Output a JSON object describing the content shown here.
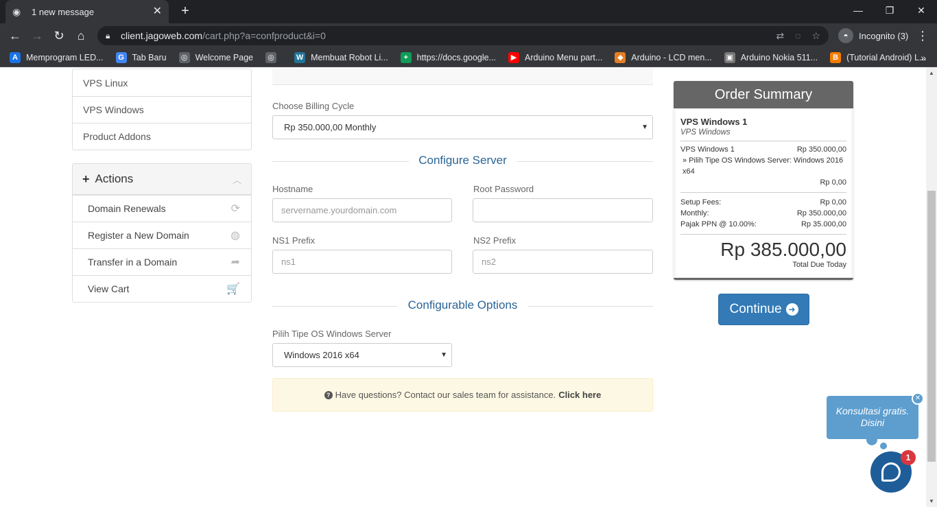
{
  "browser": {
    "tab_title": "1 new message",
    "url_host": "client.jagoweb.com",
    "url_path": "/cart.php?a=confproduct&i=0",
    "incognito_label": "Incognito (3)",
    "bookmarks": [
      {
        "label": "Memprogram LED...",
        "icon": "A",
        "color": "#1a73e8"
      },
      {
        "label": "Tab Baru",
        "icon": "G",
        "color": "#4285f4"
      },
      {
        "label": "Welcome Page",
        "icon": "◎",
        "color": "#5f6368"
      },
      {
        "label": "",
        "icon": "◎",
        "color": "#5f6368"
      },
      {
        "label": "Membuat Robot Li...",
        "icon": "W",
        "color": "#21759b"
      },
      {
        "label": "https://docs.google...",
        "icon": "+",
        "color": "#0f9d58"
      },
      {
        "label": "Arduino Menu part...",
        "icon": "▶",
        "color": "#ff0000"
      },
      {
        "label": "Arduino - LCD men...",
        "icon": "◆",
        "color": "#e67e22"
      },
      {
        "label": "Arduino Nokia 511...",
        "icon": "▣",
        "color": "#777777"
      },
      {
        "label": "(Tutorial Android) L...",
        "icon": "B",
        "color": "#f57d00"
      }
    ]
  },
  "sidebar": {
    "categories": [
      "VPS Linux",
      "VPS Windows",
      "Product Addons"
    ],
    "actions_title": "Actions",
    "actions": [
      {
        "label": "Domain Renewals",
        "icon": "refresh-icon",
        "glyph": "⟳"
      },
      {
        "label": "Register a New Domain",
        "icon": "globe-icon",
        "glyph": "◍"
      },
      {
        "label": "Transfer in a Domain",
        "icon": "share-icon",
        "glyph": "➦"
      },
      {
        "label": "View Cart",
        "icon": "cart-icon",
        "glyph": "🛒"
      }
    ]
  },
  "form": {
    "billing_label": "Choose Billing Cycle",
    "billing_value": "Rp 350.000,00 Monthly",
    "configure_server_title": "Configure Server",
    "hostname_label": "Hostname",
    "hostname_placeholder": "servername.yourdomain.com",
    "root_password_label": "Root Password",
    "ns1_label": "NS1 Prefix",
    "ns1_placeholder": "ns1",
    "ns2_label": "NS2 Prefix",
    "ns2_placeholder": "ns2",
    "configurable_options_title": "Configurable Options",
    "os_label": "Pilih Tipe OS Windows Server",
    "os_value": "Windows 2016 x64",
    "help_text": "Have questions? Contact our sales team for assistance.",
    "help_link": "Click here"
  },
  "summary": {
    "title": "Order Summary",
    "product_name": "VPS Windows 1",
    "product_group": "VPS Windows",
    "line_item": "VPS Windows 1",
    "line_price": "Rp 350.000,00",
    "option_text": "» Pilih Tipe OS Windows Server: Windows 2016 x64",
    "option_price": "Rp 0,00",
    "setup_label": "Setup Fees:",
    "setup_value": "Rp 0,00",
    "monthly_label": "Monthly:",
    "monthly_value": "Rp 350.000,00",
    "tax_label": "Pajak PPN @ 10.00%:",
    "tax_value": "Rp 35.000,00",
    "total": "Rp 385.000,00",
    "total_label": "Total Due Today",
    "continue_label": "Continue"
  },
  "chat": {
    "bubble_text": "Konsultasi gratis. Disini",
    "badge_count": "1"
  }
}
